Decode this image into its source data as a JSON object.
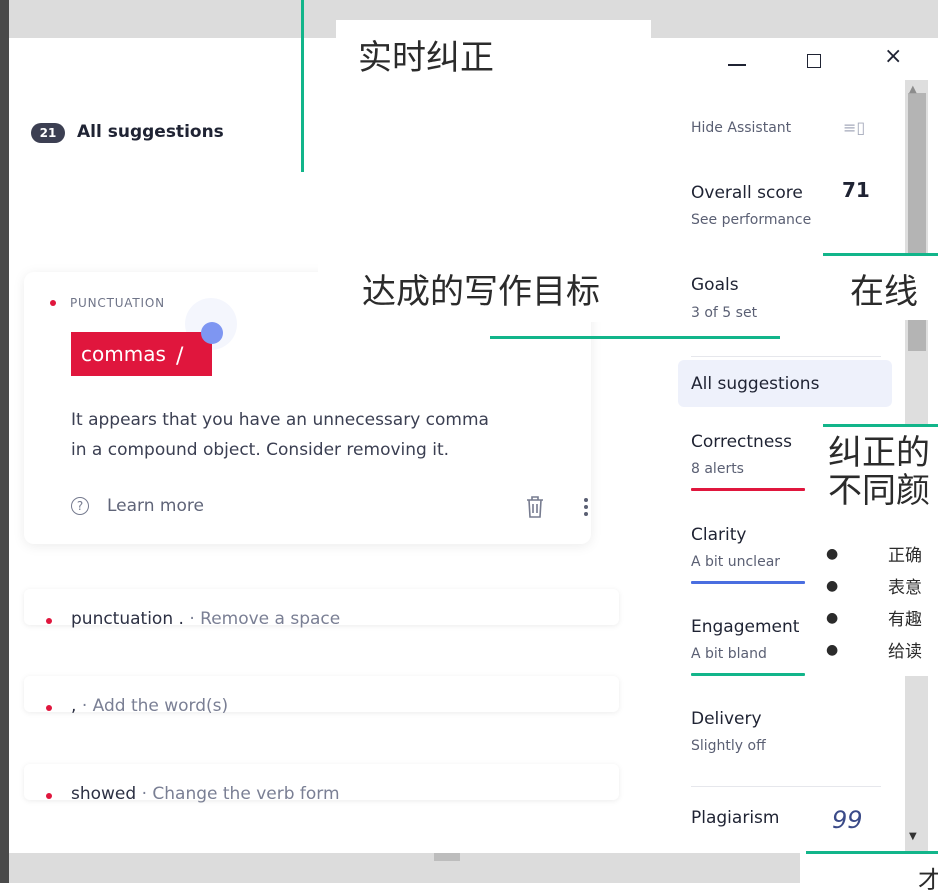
{
  "header": {
    "count": "21",
    "title": "All suggestions"
  },
  "card": {
    "category": "PUNCTUATION",
    "highlight": "commas",
    "highlight_slash": "/",
    "description_line1": "It appears that you have an unnecessary comma",
    "description_line2": "in a compound object. Consider removing it.",
    "learn_icon": "?",
    "learn_more": "Learn more"
  },
  "rows": [
    {
      "term": "punctuation .",
      "separator": "·",
      "action": "Remove a space"
    },
    {
      "term": ",",
      "separator": "·",
      "action": "Add the word(s)"
    },
    {
      "term": "showed",
      "separator": "·",
      "action": "Change the verb form"
    }
  ],
  "window_controls": {
    "minimize": "—",
    "maximize": "☐",
    "close": "×"
  },
  "sidebar": {
    "hide_assistant": "Hide Assistant",
    "hide_icon": "≡▯",
    "score_label": "Overall score",
    "score_value": "71",
    "score_link": "See performance",
    "goals_label": "Goals",
    "goals_count": "3 of 5 set",
    "all_suggestions": "All suggestions",
    "categories": [
      {
        "label": "Correctness",
        "sub": "8 alerts",
        "color": "#e0163d"
      },
      {
        "label": "Clarity",
        "sub": "A bit unclear",
        "color": "#4a6ee0"
      },
      {
        "label": "Engagement",
        "sub": "A bit bland",
        "color": "#12b58a"
      },
      {
        "label": "Delivery",
        "sub": "Slightly off",
        "color": ""
      }
    ],
    "plagiarism": "Plagiarism",
    "plagiarism_icon": "99"
  },
  "scrollbar": {
    "up": "▲",
    "down": "▼"
  },
  "annotations": {
    "realtime": "实时纠正",
    "goals": "达成的写作目标",
    "online": "在线",
    "colors_line1": "纠正的",
    "colors_line2": "不同颜",
    "color_items": [
      "正确",
      "表意",
      "有趣",
      "给读"
    ],
    "bottom": "才"
  },
  "colors": {
    "accent_green": "#12b58a",
    "alert_red": "#e0163d",
    "clarity_blue": "#4a6ee0"
  }
}
